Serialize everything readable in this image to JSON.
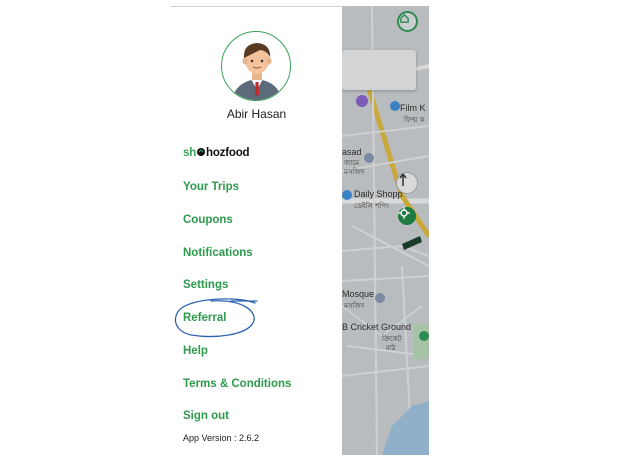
{
  "drawer": {
    "user_name": "Abir Hasan",
    "brand": {
      "part1": "sh",
      "part2": "hoz",
      "part3": "food"
    },
    "menu": [
      {
        "label": "Your Trips"
      },
      {
        "label": "Coupons"
      },
      {
        "label": "Notifications"
      },
      {
        "label": "Settings"
      },
      {
        "label": "Referral"
      },
      {
        "label": "Help"
      },
      {
        "label": "Terms & Conditions"
      },
      {
        "label": "Sign out"
      }
    ],
    "app_version": "App Version : 2.6.2"
  },
  "map": {
    "labels": {
      "film": "Film K",
      "film_sub": "ফিল্ম ক",
      "masjid": "asad",
      "masjid_sub": "জামে",
      "masjid_sub2": "মসজিদ",
      "daily_shop": "Daily Shopp",
      "daily_shop_sub": "ডেইলি শপিং",
      "mosque": "Mosque",
      "mosque_sub": "মসজিদ",
      "cricket": "B Cricket Ground",
      "cricket_sub": "ক্রিকেট",
      "cricket_sub2": "মাঠ"
    }
  },
  "colors": {
    "accent_green": "#2d9a4c",
    "map_bg": "#b9bcbf",
    "scribble": "#2f64b3"
  },
  "icons": {
    "home": "home-icon",
    "compass": "compass-icon",
    "locate": "locate-icon",
    "pin": "map-pin-icon"
  }
}
